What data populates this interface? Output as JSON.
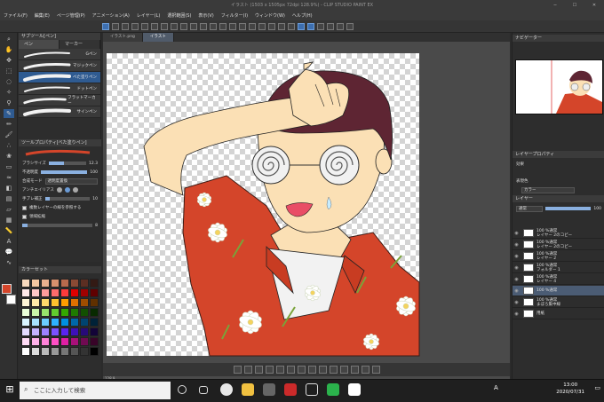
{
  "app": {
    "title": "イラスト (1503 x 1505px 72dpi 128.9%) - CLIP STUDIO PAINT EX"
  },
  "menu": [
    "ファイル(F)",
    "編集(E)",
    "ページ管理(P)",
    "アニメーション(A)",
    "レイヤー(L)",
    "選択範囲(S)",
    "表示(V)",
    "フィルター(I)",
    "ウィンドウ(W)",
    "ヘルプ(H)"
  ],
  "subtool": {
    "title": "サブツール[ペン]",
    "tabs": [
      "ペン",
      "マーカー"
    ],
    "brushes": [
      "Gペン",
      "マジックペン",
      "べた塗りペン",
      "ドットペン",
      "フラットマーカー",
      "サインペン"
    ],
    "selected_index": 2
  },
  "tool_property": {
    "title": "ツールプロパティ[べた塗りペン]",
    "brush_name": "べた塗りペン",
    "brush_size_label": "ブラシサイズ",
    "brush_size_value": "12.3",
    "opacity_label": "不透明度",
    "opacity_value": "100",
    "blend_label": "合成モード",
    "blend_value": "透明度置換",
    "antialias_label": "アンチエイリアス",
    "stabilization_label": "手ブレ補正",
    "stabilization_value": "10",
    "ref_label": "複数レイヤーの線を参照する",
    "area_label": "領域拡縮",
    "area_value": "8"
  },
  "colorset": {
    "title": "カラーセット"
  },
  "swatches": [
    "#f7d9bd",
    "#f3c6a0",
    "#eab08f",
    "#d8916e",
    "#b96a4d",
    "#8a4a34",
    "#5c2e22",
    "#331a14",
    "#ffe9e9",
    "#ffc7c7",
    "#ff9c9c",
    "#ff6b6b",
    "#ff3b3b",
    "#e00000",
    "#a00000",
    "#600000",
    "#fff6d6",
    "#ffe9a8",
    "#ffd86b",
    "#ffc22e",
    "#ff9d00",
    "#e07000",
    "#a04d00",
    "#603000",
    "#eaffd9",
    "#c9f5a8",
    "#98e36b",
    "#62cc2e",
    "#34a800",
    "#1f7a00",
    "#125000",
    "#082a00",
    "#d9f4ff",
    "#a8e3ff",
    "#6bcdff",
    "#2eb2ff",
    "#0090e0",
    "#0068a8",
    "#004470",
    "#002238",
    "#e4dcff",
    "#c4b2ff",
    "#9d82ff",
    "#7b52ff",
    "#5a24f0",
    "#3d10b8",
    "#270a78",
    "#130438",
    "#ffdcf6",
    "#ffb2ea",
    "#ff82d9",
    "#ff4fc6",
    "#e01fa4",
    "#a8107a",
    "#700a52",
    "#380428",
    "#ffffff",
    "#dddddd",
    "#bbbbbb",
    "#999999",
    "#777777",
    "#555555",
    "#333333",
    "#000000"
  ],
  "canvas": {
    "tabs": [
      "イラスト.png",
      "イラスト"
    ],
    "selected_tab": 1,
    "zoom": "128.9"
  },
  "navigator": {
    "title": "ナビゲーター"
  },
  "layer_property": {
    "title": "レイヤープロパティ",
    "effect_label": "効果",
    "display_color_label": "表現色",
    "display_color_value": "カラー"
  },
  "layers_panel": {
    "title": "レイヤー",
    "blend": "通常",
    "opacity": "100"
  },
  "layers": [
    {
      "line1": "100 %通常",
      "line2": "レイヤー 2のコピー",
      "selected": false
    },
    {
      "line1": "100 %通常",
      "line2": "レイヤー 2のコピー",
      "selected": false
    },
    {
      "line1": "100 %通常",
      "line2": "レイヤー 2",
      "selected": false
    },
    {
      "line1": "100 %通常",
      "line2": "フォルダー 1",
      "selected": false
    },
    {
      "line1": "100 %通常",
      "line2": "レイヤー 4",
      "selected": false
    },
    {
      "line1": "100 %通常",
      "line2": "",
      "selected": true
    },
    {
      "line1": "100 %通常",
      "line2": "まぼろ集中線",
      "selected": false
    },
    {
      "line1": "",
      "line2": "用紙",
      "selected": false
    }
  ],
  "taskbar": {
    "search_placeholder": "ここに入力して検索",
    "time": "13:00",
    "date": "2020/07/31",
    "ime": "A"
  },
  "colors": {
    "accent": "#2f5b91",
    "hair": "#5e2533",
    "shirt": "#d4452a",
    "skin": "#fbe0b5"
  }
}
